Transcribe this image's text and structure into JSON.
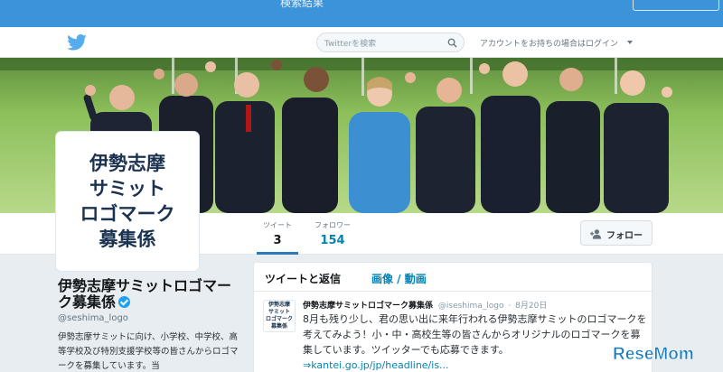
{
  "top_strip": {
    "text": "検索結果"
  },
  "nav": {
    "search_placeholder": "Twitterを検索",
    "account_question": "アカウントをお持ちの場合は",
    "login": "ログイン"
  },
  "avatar": {
    "lines": [
      "伊勢志摩",
      "サミット",
      "ロゴマーク",
      "募集係"
    ]
  },
  "profile": {
    "name": "伊勢志摩サミットロゴマーク募集係",
    "handle": "@seshima_logo",
    "bio": "伊勢志摩サミットに向け、小学校、中学校、高等学校及び特別支援学校等の皆さんからロゴマークを募集しています。当"
  },
  "stats": {
    "tweets_label": "ツイート",
    "tweets_value": "3",
    "followers_label": "フォロワー",
    "followers_value": "154"
  },
  "follow_button": {
    "label": "フォロー"
  },
  "timeline": {
    "tab_tweets": "ツイートと返信",
    "tab_media": "画像 / 動画"
  },
  "tweet": {
    "avatar_lines": [
      "伊勢志摩",
      "サミット",
      "ロゴマーク",
      "募集係"
    ],
    "name": "伊勢志摩サミットロゴマーク募集係",
    "handle": "@iseshima_logo",
    "dot": "·",
    "date": "8月20日",
    "text": "8月も残り少し、君の思い出に来年行われる伊勢志摩サミットのロゴマークを考えてみよう！小・中・高校生等の皆さんからオリジナルのロゴマークを募集しています。ツイッターでも応募できます。",
    "link": "⇒kantei.go.jp/jp/headline/is..."
  },
  "watermark": {
    "text": "ReseMom",
    "color": "#1a7bbf"
  },
  "colors": {
    "accent": "#3b94d9",
    "link": "#0084b4",
    "brand_twitter": "#55acee"
  }
}
